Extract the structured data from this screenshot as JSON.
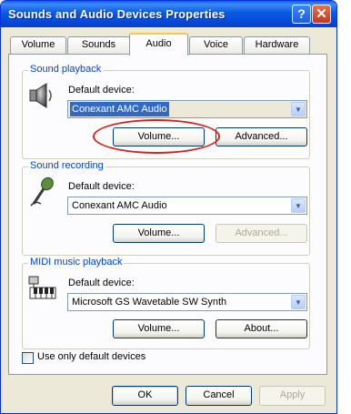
{
  "window": {
    "title": "Sounds and Audio Devices Properties"
  },
  "titlebar": {
    "help_glyph": "?",
    "close_glyph": "✕"
  },
  "tabs": [
    {
      "label": "Volume"
    },
    {
      "label": "Sounds"
    },
    {
      "label": "Audio"
    },
    {
      "label": "Voice"
    },
    {
      "label": "Hardware"
    }
  ],
  "playback": {
    "group_label": "Sound playback",
    "default_label": "Default device:",
    "device": "Conexant AMC Audio",
    "volume_label": "Volume...",
    "advanced_label": "Advanced..."
  },
  "recording": {
    "group_label": "Sound recording",
    "default_label": "Default device:",
    "device": "Conexant AMC Audio",
    "volume_label": "Volume...",
    "advanced_label": "Advanced..."
  },
  "midi": {
    "group_label": "MIDI music playback",
    "default_label": "Default device:",
    "device": "Microsoft GS Wavetable SW Synth",
    "volume_label": "Volume...",
    "about_label": "About..."
  },
  "options": {
    "use_default_label": "Use only default devices",
    "use_default_checked": false
  },
  "footer": {
    "ok_label": "OK",
    "cancel_label": "Cancel",
    "apply_label": "Apply"
  },
  "colors": {
    "accent": "#0046d5",
    "highlight_ring": "#d9241c",
    "selection": "#316ac5"
  }
}
